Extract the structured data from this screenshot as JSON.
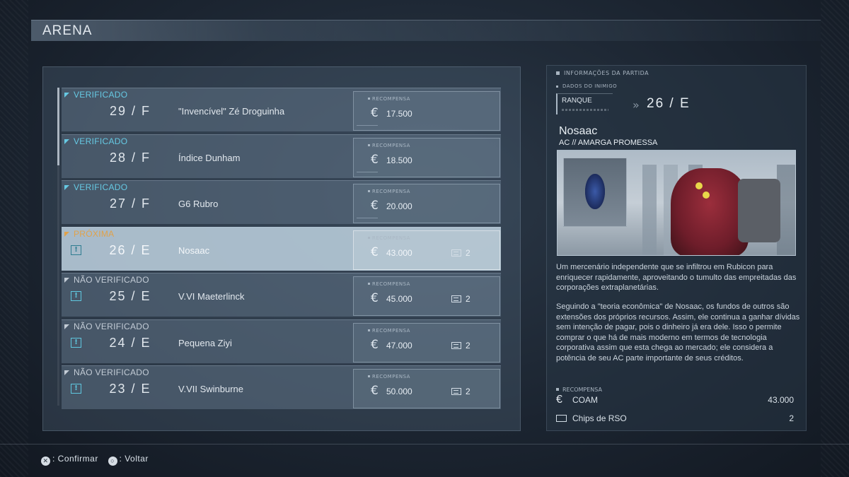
{
  "header": {
    "title": "ARENA"
  },
  "missions": [
    {
      "status": "VERIFICADO",
      "status_kind": "verified",
      "rank": "29 / F",
      "name": "\"Invencível\" Zé Droguinha",
      "reward_label": "RECOMPENSA",
      "reward": "17.500",
      "chips": ""
    },
    {
      "status": "VERIFICADO",
      "status_kind": "verified",
      "rank": "28 / F",
      "name": "Índice Dunham",
      "reward_label": "RECOMPENSA",
      "reward": "18.500",
      "chips": ""
    },
    {
      "status": "VERIFICADO",
      "status_kind": "verified",
      "rank": "27 / F",
      "name": "G6 Rubro",
      "reward_label": "RECOMPENSA",
      "reward": "20.000",
      "chips": ""
    },
    {
      "status": "PRÓXIMA",
      "status_kind": "next",
      "rank": "26 / E",
      "name": "Nosaac",
      "reward_label": "RECOMPENSA",
      "reward": "43.000",
      "chips": "2"
    },
    {
      "status": "NÃO VERIFICADO",
      "status_kind": "unverified",
      "rank": "25 / E",
      "name": "V.VI Maeterlinck",
      "reward_label": "RECOMPENSA",
      "reward": "45.000",
      "chips": "2"
    },
    {
      "status": "NÃO VERIFICADO",
      "status_kind": "unverified",
      "rank": "24 / E",
      "name": "Pequena Ziyi",
      "reward_label": "RECOMPENSA",
      "reward": "47.000",
      "chips": "2"
    },
    {
      "status": "NÃO VERIFICADO",
      "status_kind": "unverified",
      "rank": "23 / E",
      "name": "V.VII Swinburne",
      "reward_label": "RECOMPENSA",
      "reward": "50.000",
      "chips": "2"
    }
  ],
  "detail": {
    "section_title": "INFORMAÇÕES DA PARTIDA",
    "enemy_data_label": "DADOS DO INIMIGO",
    "rank_label": "RANQUE",
    "rank_value": "26 / E",
    "enemy_name": "Nosaac",
    "enemy_ac": "AC // AMARGA PROMESSA",
    "desc1": "Um mercenário independente que se infiltrou em Rubicon para enriquecer rapidamente, aproveitando o tumulto das empreitadas das corporações extraplanetárias.",
    "desc2": "Seguindo a \"teoria econômica\" de Nosaac, os fundos de outros são extensões dos próprios recursos. Assim, ele continua a ganhar dívidas sem intenção de pagar, pois o dinheiro já era dele. Isso o permite comprar o que há de mais moderno em termos de tecnologia corporativa assim que esta chega ao mercado; ele considera a potência de seu AC parte importante de seus créditos.",
    "reward_label": "RECOMPENSA",
    "coam_label": "COAM",
    "coam_value": "43.000",
    "chips_label": "Chips de RSO",
    "chips_value": "2"
  },
  "controls": {
    "confirm_symbol": "✕",
    "confirm": ": Confirmar",
    "back_symbol": "○",
    "back": ": Voltar"
  },
  "icons": {
    "currency": "euro-icon",
    "chip": "chip-icon",
    "alert": "alert-icon"
  },
  "colors": {
    "verified": "#66c9e3",
    "next": "#e0a24a",
    "unverified": "#c3ccd6"
  }
}
